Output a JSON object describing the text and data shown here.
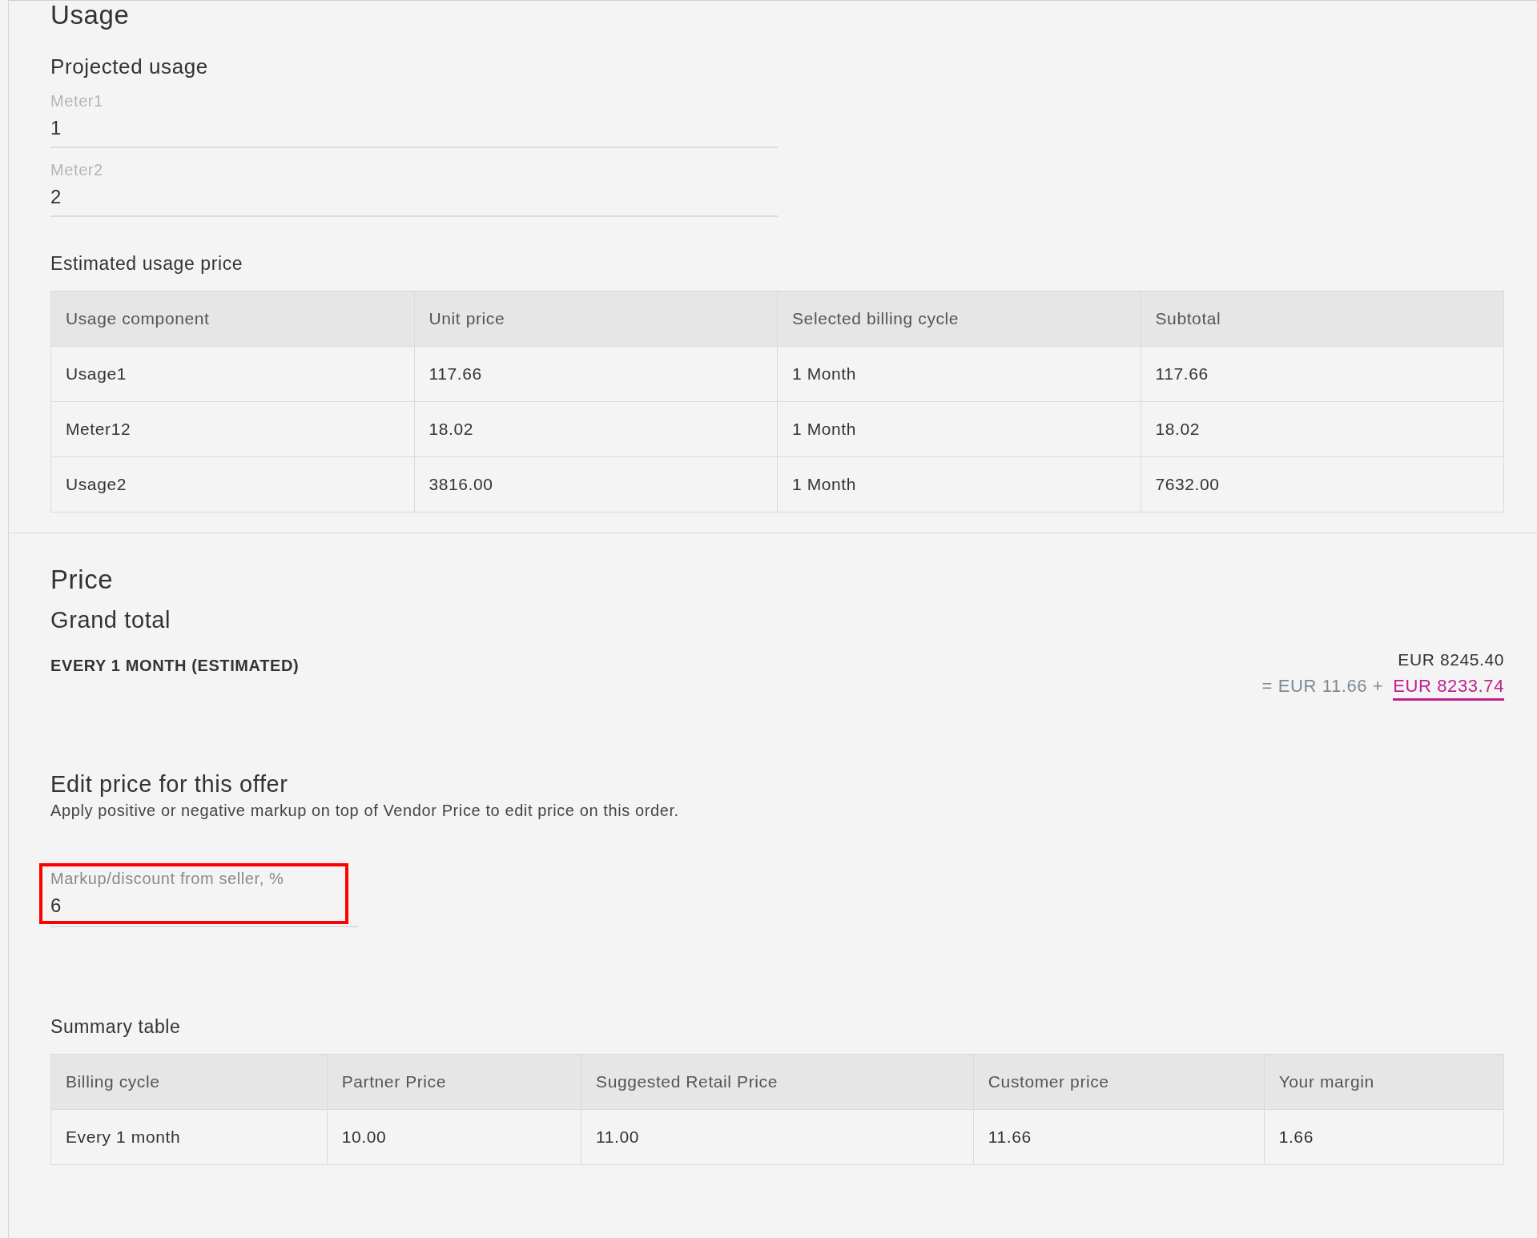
{
  "usage": {
    "title": "Usage",
    "projected_title": "Projected usage",
    "meters": [
      {
        "label": "Meter1",
        "value": "1"
      },
      {
        "label": "Meter2",
        "value": "2"
      }
    ],
    "estimate_title": "Estimated usage price",
    "table": {
      "columns": [
        "Usage component",
        "Unit price",
        "Selected billing cycle",
        "Subtotal"
      ],
      "rows": [
        [
          "Usage1",
          "117.66",
          "1 Month",
          "117.66"
        ],
        [
          "Meter12",
          "18.02",
          "1 Month",
          "18.02"
        ],
        [
          "Usage2",
          "3816.00",
          "1 Month",
          "7632.00"
        ]
      ]
    }
  },
  "price": {
    "title": "Price",
    "grand_total_title": "Grand total",
    "period": "EVERY 1 MONTH (ESTIMATED)",
    "total": "EUR 8245.40",
    "breakdown_base": "= EUR 11.66 +",
    "breakdown_link": "EUR 8233.74"
  },
  "edit": {
    "title": "Edit price for this offer",
    "description": "Apply positive or negative markup on top of Vendor Price to edit price on this order.",
    "field": {
      "label": "Markup/discount from seller, %",
      "value": "6",
      "highlighted": true
    }
  },
  "summary": {
    "title": "Summary table",
    "table": {
      "columns": [
        "Billing cycle",
        "Partner Price",
        "Suggested Retail Price",
        "Customer price",
        "Your margin"
      ],
      "rows": [
        [
          "Every 1 month",
          "10.00",
          "11.00",
          "11.66",
          "1.66"
        ]
      ]
    }
  }
}
